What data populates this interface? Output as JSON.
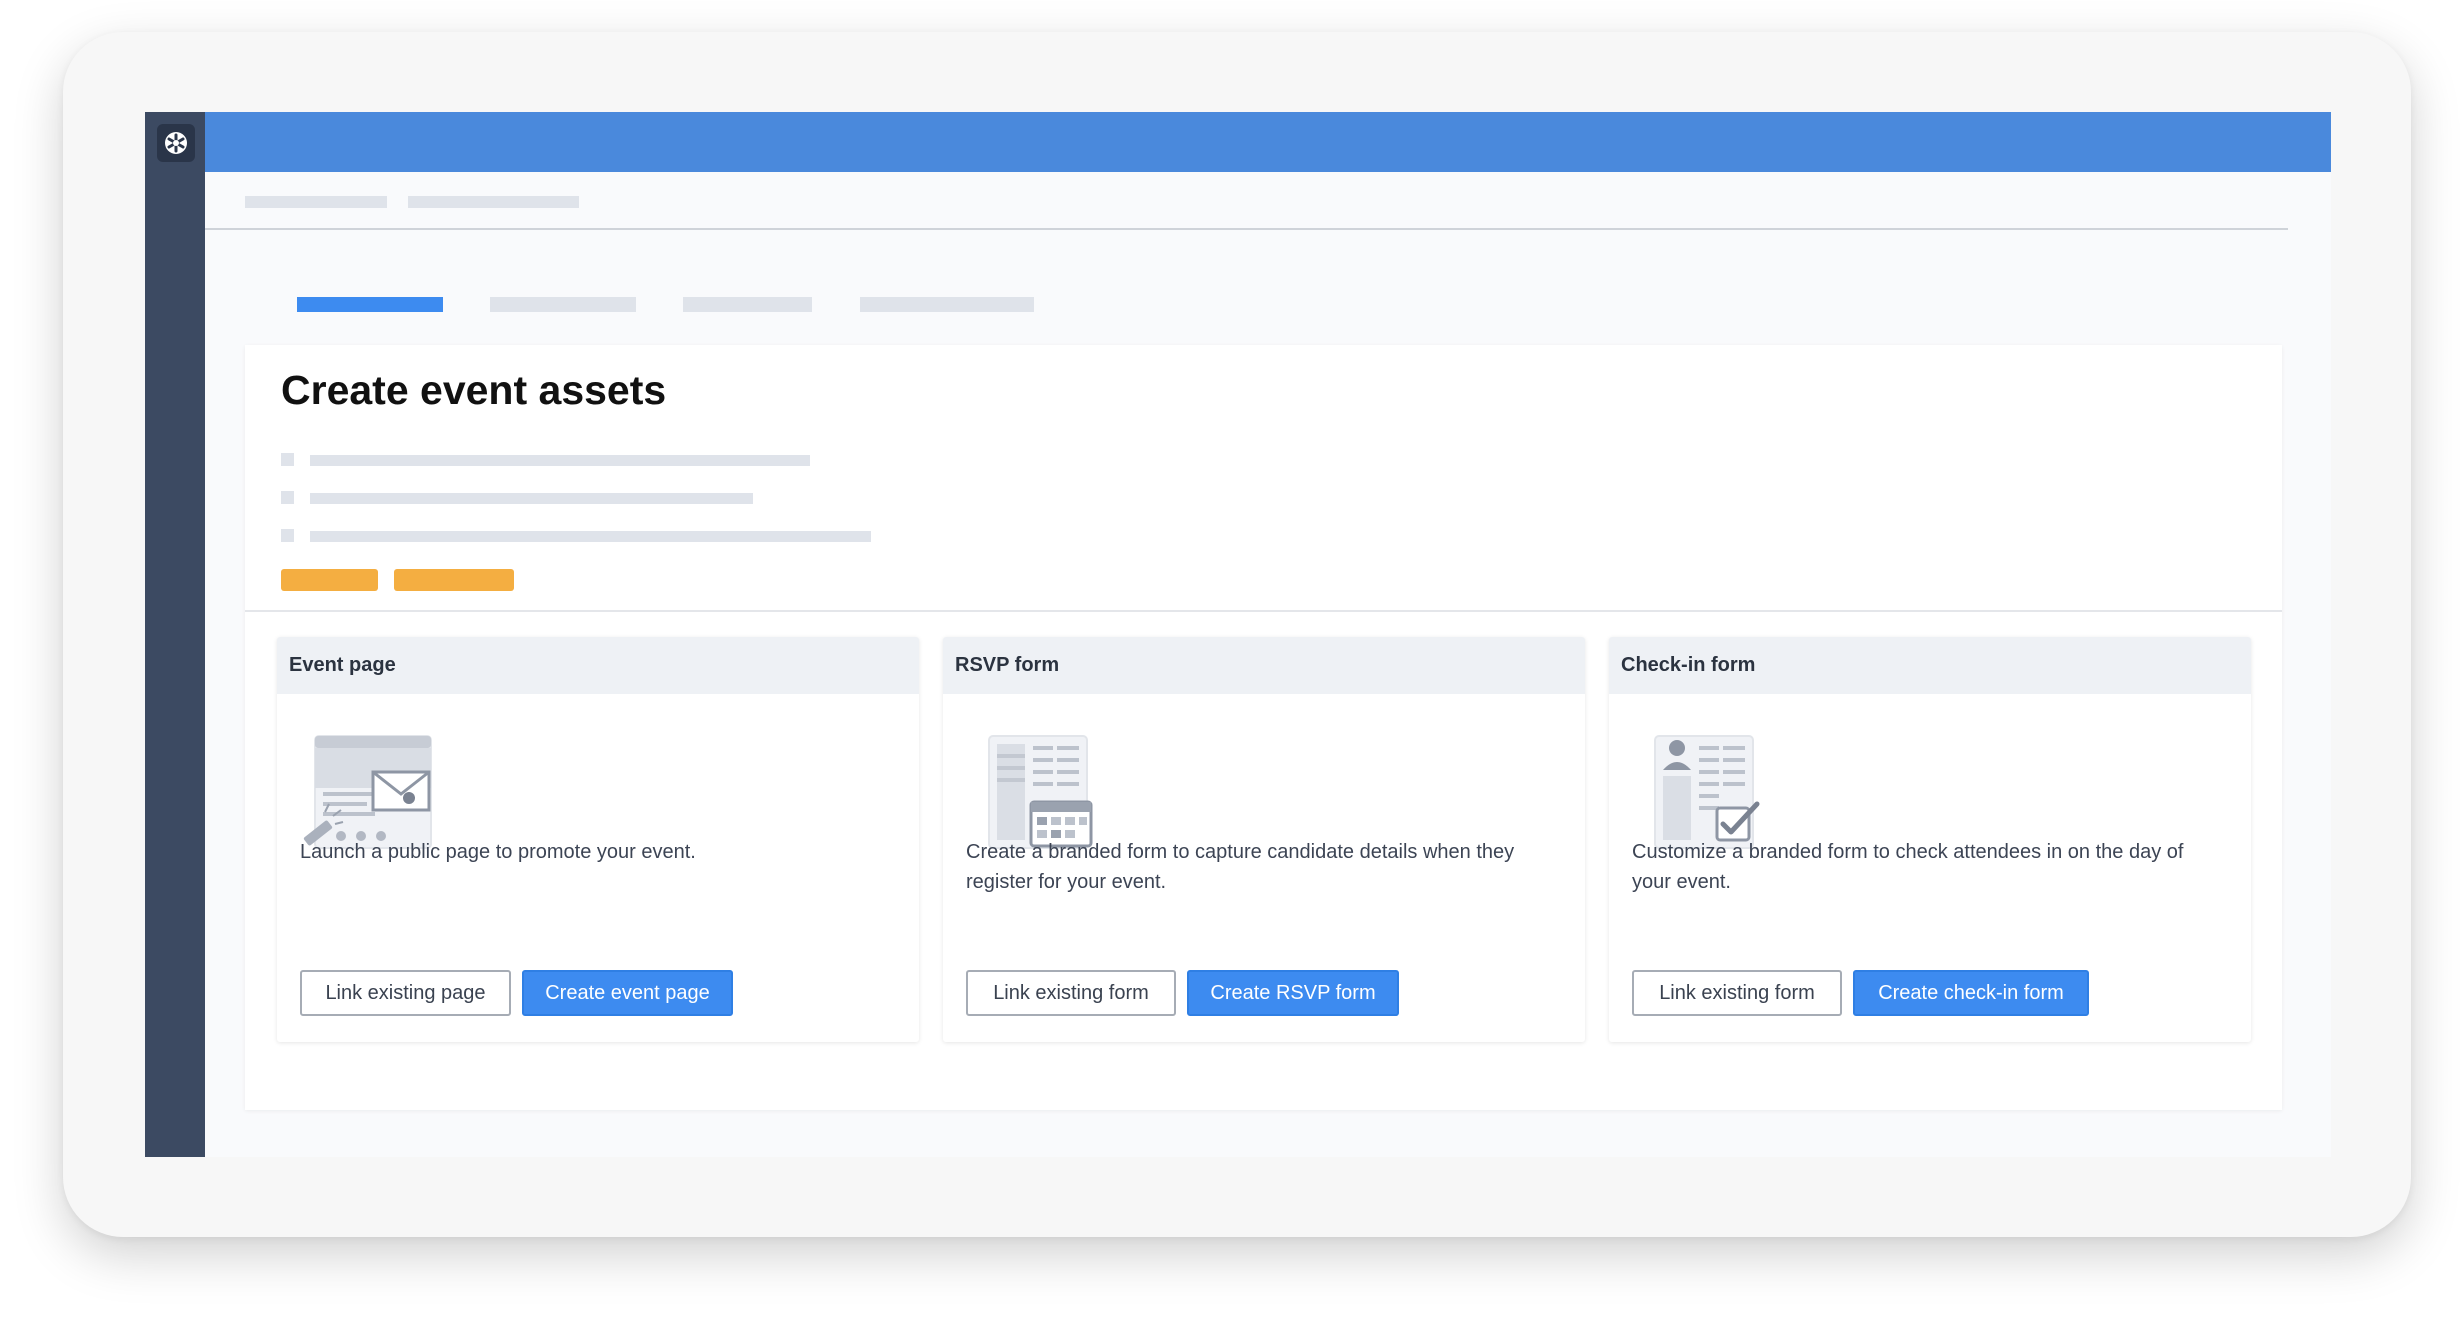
{
  "page": {
    "title": "Create event assets"
  },
  "panels": [
    {
      "title": "Event page",
      "description": "Launch a public page to promote your event.",
      "secondary_button": "Link existing page",
      "primary_button": "Create event page",
      "icon": "event-page-illustration"
    },
    {
      "title": "RSVP form",
      "description": "Create a branded form to capture candidate details when they register for your event.",
      "secondary_button": "Link existing form",
      "primary_button": "Create RSVP form",
      "icon": "rsvp-form-illustration"
    },
    {
      "title": "Check-in form",
      "description": "Customize a branded form to check attendees in on the day of your event.",
      "secondary_button": "Link existing form",
      "primary_button": "Create check-in form",
      "icon": "check-in-form-illustration"
    }
  ],
  "colors": {
    "topbar": "#4a89dc",
    "sidebar": "#3c4a62",
    "primary": "#3d8bf0",
    "accent": "#f4ae41",
    "active_tab": "#3d8bf0",
    "placeholder": "#dfe3ea"
  },
  "tabs": {
    "active_index": 0,
    "count": 4
  }
}
